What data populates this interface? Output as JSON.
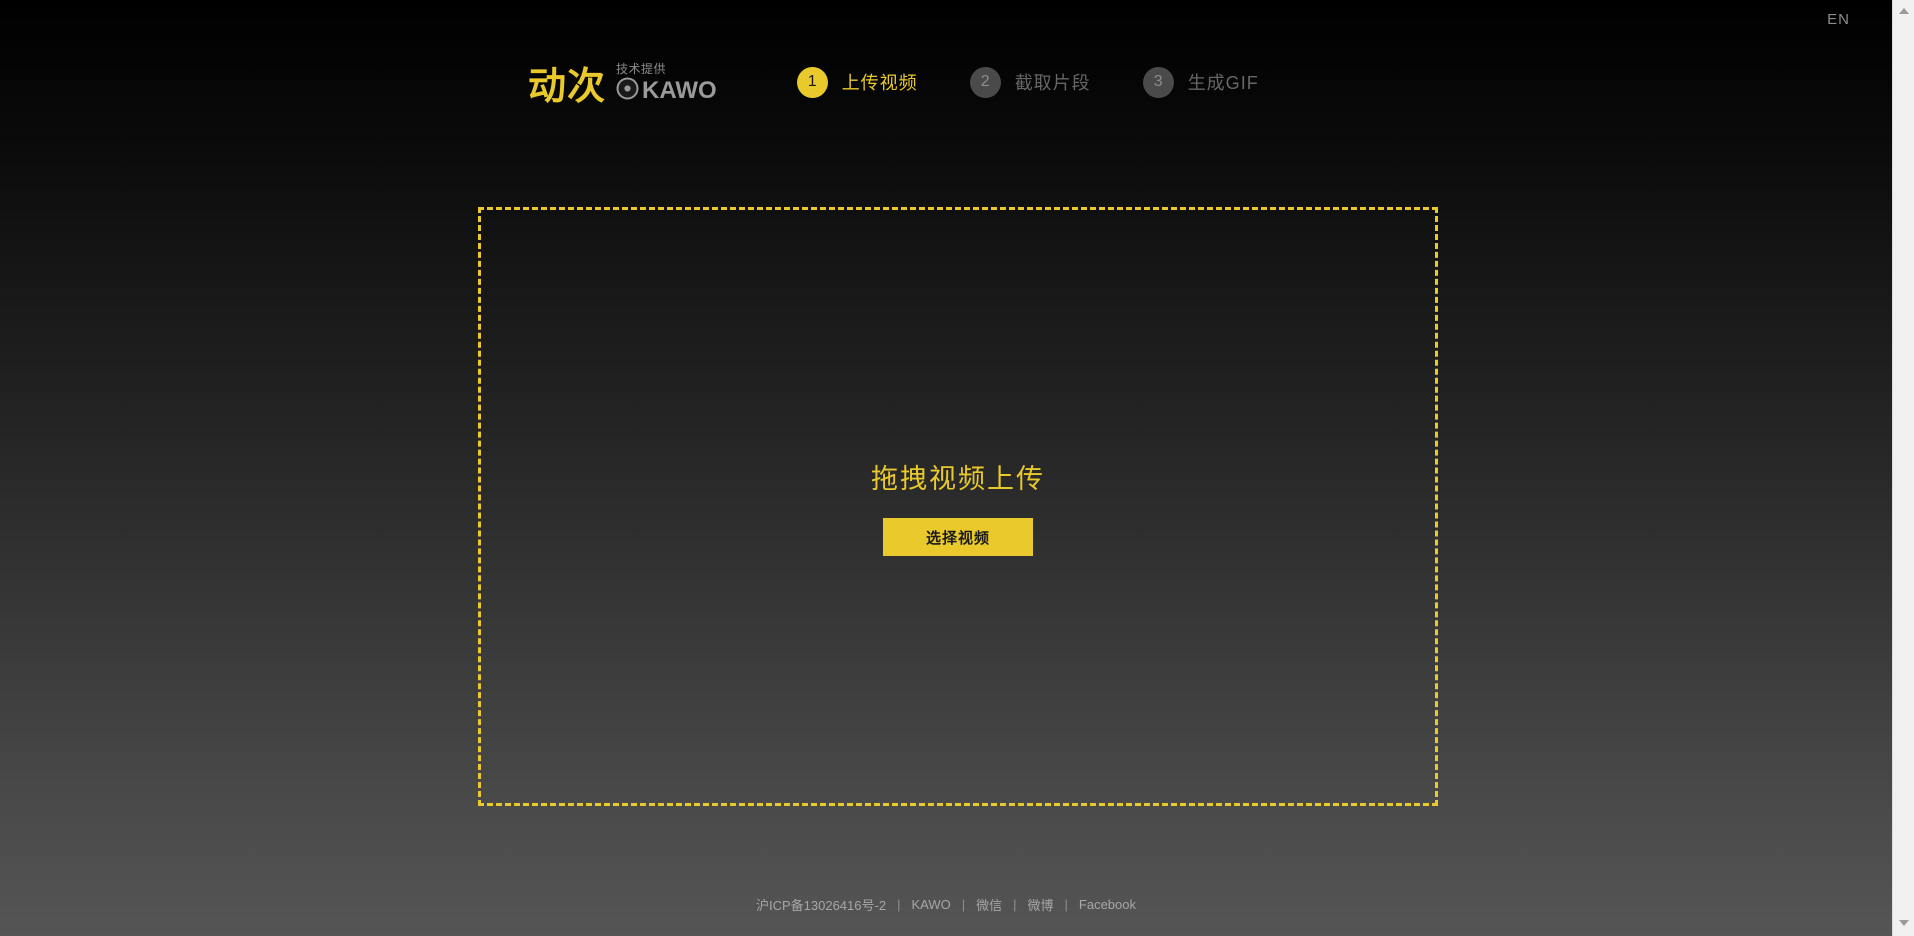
{
  "language_switch": {
    "label": "EN"
  },
  "brand": {
    "name": "动次",
    "credit_label": "技术提供",
    "partner_name": "KAWO",
    "accent_color": "#e9c92b"
  },
  "steps": [
    {
      "number": "1",
      "label": "上传视频",
      "state": "active"
    },
    {
      "number": "2",
      "label": "截取片段",
      "state": "inactive"
    },
    {
      "number": "3",
      "label": "生成GIF",
      "state": "inactive"
    }
  ],
  "dropzone": {
    "title": "拖拽视频上传",
    "button_label": "选择视频",
    "border_color": "#e9c92b"
  },
  "footer": {
    "icp": "沪ICP备13026416号-2",
    "separator": "|",
    "links": [
      {
        "label": "KAWO"
      },
      {
        "label": "微信"
      },
      {
        "label": "微博"
      },
      {
        "label": "Facebook"
      }
    ]
  }
}
